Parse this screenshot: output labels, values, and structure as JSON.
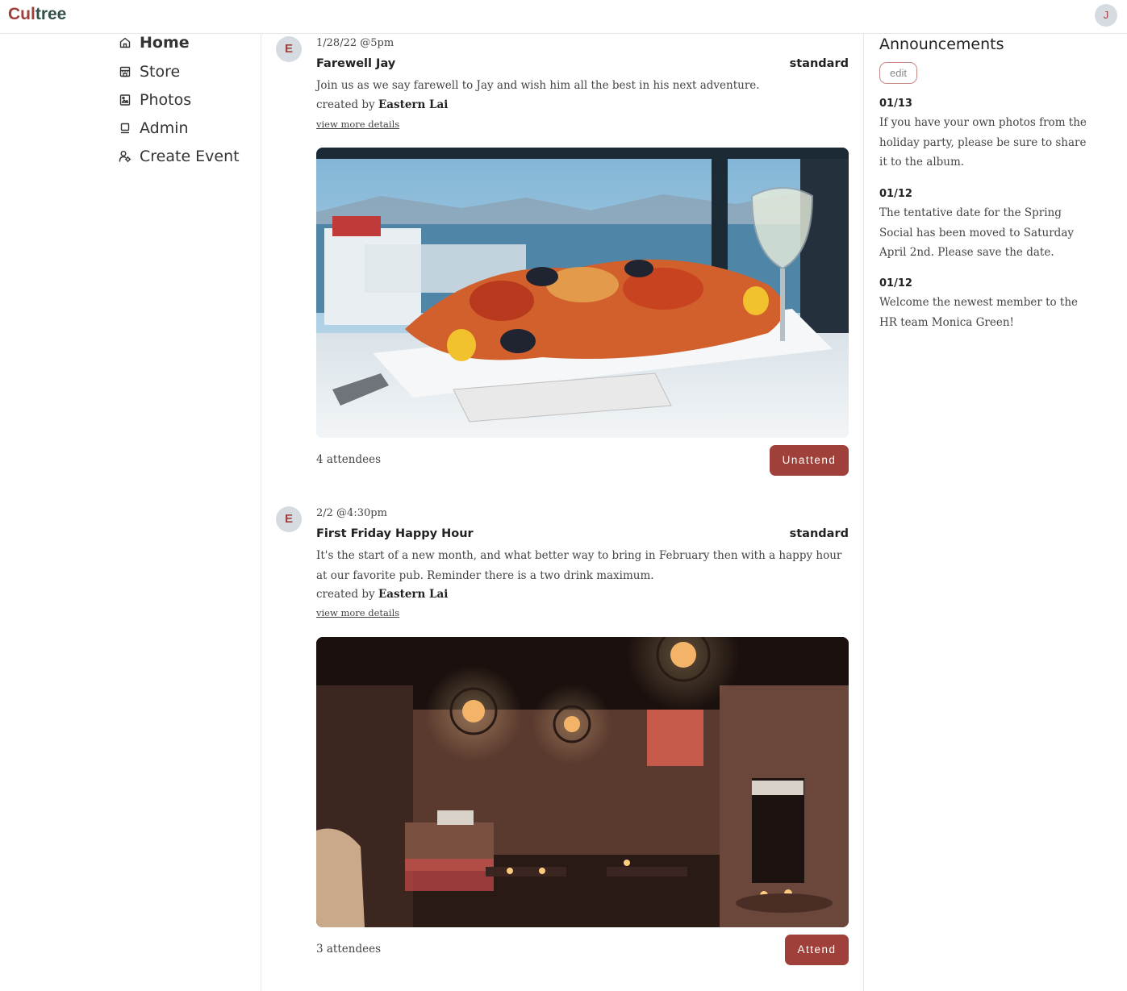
{
  "app": {
    "logo_part1": "Cul",
    "logo_part2": "tree",
    "user_initial": "J"
  },
  "sidebar": {
    "items": [
      {
        "label": "Home",
        "icon": "home-icon"
      },
      {
        "label": "Store",
        "icon": "store-icon"
      },
      {
        "label": "Photos",
        "icon": "photos-icon"
      },
      {
        "label": "Admin",
        "icon": "admin-icon"
      },
      {
        "label": "Create Event",
        "icon": "create-event-icon"
      }
    ]
  },
  "events": [
    {
      "avatar": "E",
      "date": "1/28/22 @5pm",
      "title": "Farewell Jay",
      "type": "standard",
      "description": "Join us as we say farewell to Jay and wish him all the best in his next adventure.",
      "created_by_prefix": "created by",
      "creator": "Eastern Lai",
      "more_link": "view more details",
      "attendees": "4 attendees",
      "button": "Unattend"
    },
    {
      "avatar": "E",
      "date": "2/2 @4:30pm",
      "title": "First Friday Happy Hour",
      "type": "standard",
      "description": "It's the start of a new month, and what better way to bring in February then with a happy hour at our favorite pub. Reminder there is a two drink maximum.",
      "created_by_prefix": "created by",
      "creator": "Eastern Lai",
      "more_link": "view more details",
      "attendees": "3 attendees",
      "button": "Attend"
    }
  ],
  "announcements": {
    "title": "Announcements",
    "edit_label": "edit",
    "items": [
      {
        "date": "01/13",
        "text": "If you have your own photos from the holiday party, please be sure to share it to the album."
      },
      {
        "date": "01/12",
        "text": "The tentative date for the Spring Social has been moved to Saturday April 2nd. Please save the date."
      },
      {
        "date": "01/12",
        "text": "Welcome the newest member to the HR team Monica Green!"
      }
    ]
  },
  "colors": {
    "brand_red": "#a0403a",
    "brand_green": "#35504a",
    "avatar_bg": "#d5dbe1"
  }
}
